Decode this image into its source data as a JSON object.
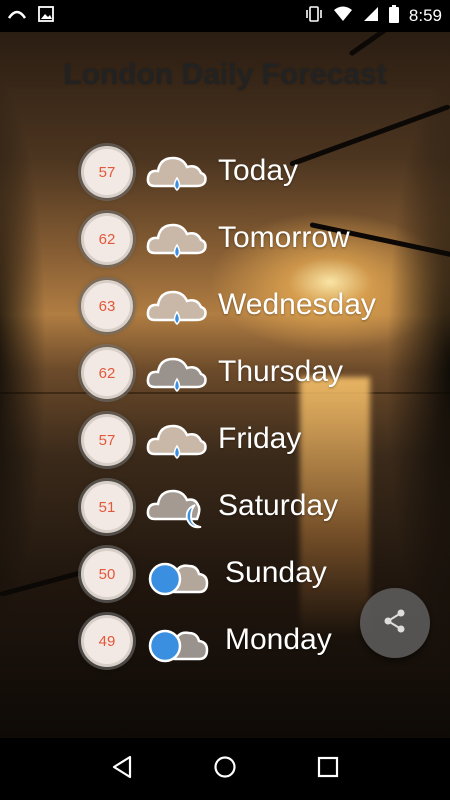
{
  "status_bar": {
    "time": "8:59",
    "icons": [
      "cast-icon",
      "image-icon",
      "vibrate-icon",
      "wifi-icon",
      "signal-icon",
      "battery-icon"
    ]
  },
  "header": {
    "title": "London Daily Forecast"
  },
  "forecast": {
    "days": [
      {
        "temp": "57",
        "day": "Today",
        "icon": "rain-cloud-icon"
      },
      {
        "temp": "62",
        "day": "Tomorrow",
        "icon": "rain-cloud-icon"
      },
      {
        "temp": "63",
        "day": "Wednesday",
        "icon": "rain-cloud-icon"
      },
      {
        "temp": "62",
        "day": "Thursday",
        "icon": "rain-cloud-icon"
      },
      {
        "temp": "57",
        "day": "Friday",
        "icon": "rain-cloud-icon"
      },
      {
        "temp": "51",
        "day": "Saturday",
        "icon": "cloudy-night-icon"
      },
      {
        "temp": "50",
        "day": "Sunday",
        "icon": "partly-cloudy-icon"
      },
      {
        "temp": "49",
        "day": "Monday",
        "icon": "partly-cloudy-icon"
      }
    ]
  },
  "fab": {
    "icon": "share-icon"
  },
  "nav_bar": {
    "icons": [
      "back-icon",
      "home-icon",
      "recents-icon"
    ]
  },
  "colors": {
    "temp_text": "#e2583a",
    "badge_bg": "#f3e9e4",
    "title": "#222222"
  }
}
